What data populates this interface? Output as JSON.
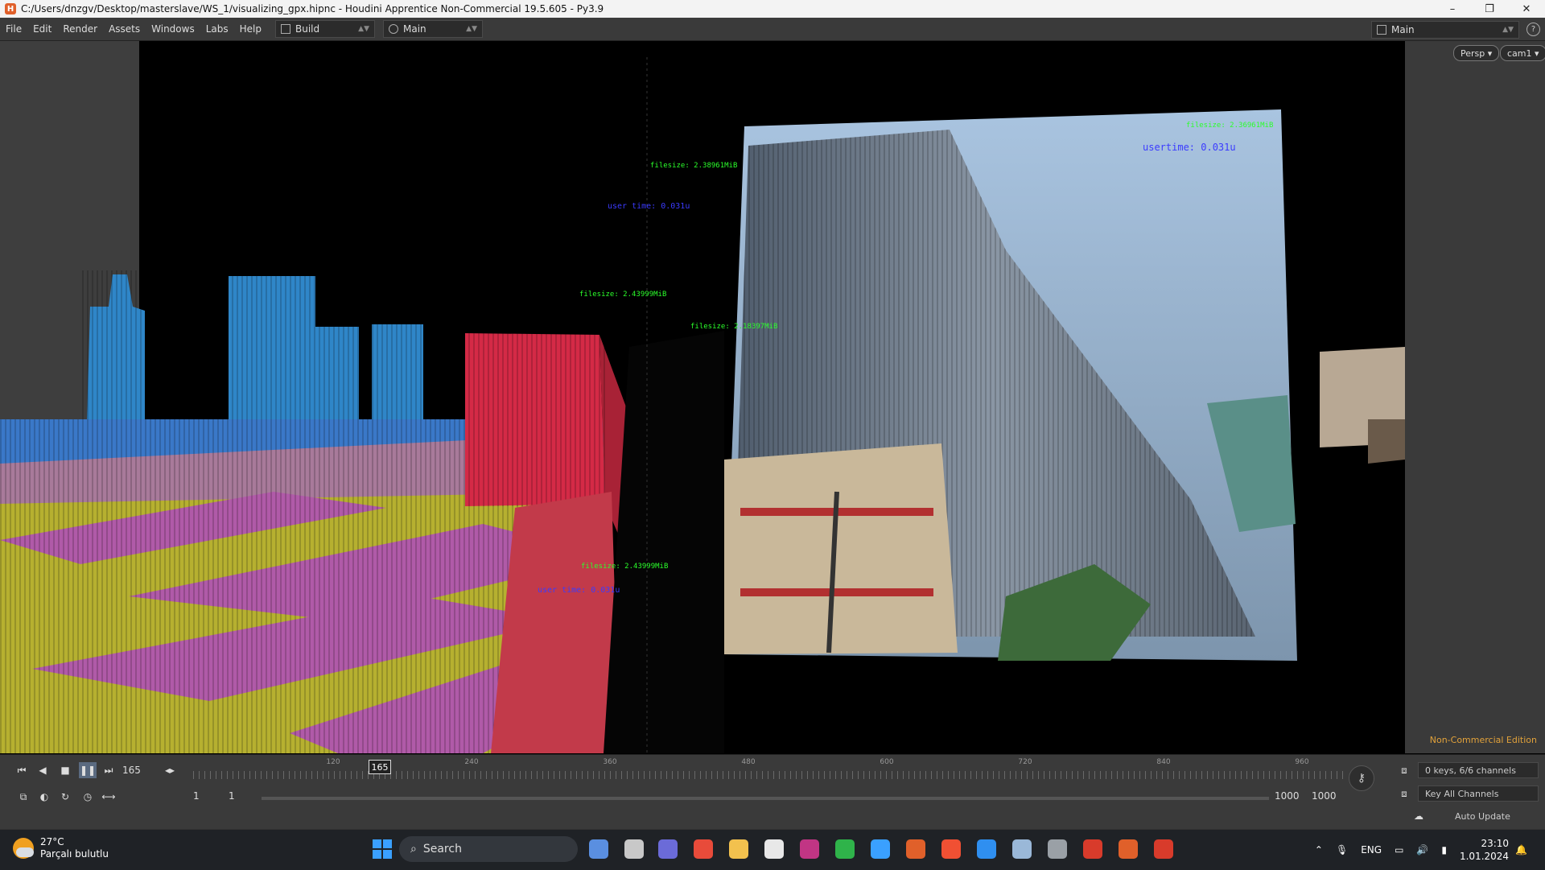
{
  "window": {
    "title": "C:/Users/dnzgv/Desktop/masterslave/WS_1/visualizing_gpx.hipnc - Houdini Apprentice Non-Commercial 19.5.605 - Py3.9",
    "app_icon": "houdini-icon",
    "controls": [
      "–",
      "❐",
      "✕"
    ]
  },
  "menubar": {
    "items": [
      "File",
      "Edit",
      "Render",
      "Assets",
      "Windows",
      "Labs",
      "Help"
    ],
    "desktop_select": "Build",
    "pane_select": "Main",
    "right_select": "Main",
    "help_label": "?"
  },
  "viewport": {
    "camera_view": "Persp",
    "camera_name": "cam1",
    "edition_label": "Non-Commercial Edition",
    "overlay_texts": [
      {
        "text": "filesize: 2.38961MiB",
        "color": "#2bff2b"
      },
      {
        "text": "filesize: 2.43999MiB",
        "color": "#2bff2b"
      },
      {
        "text": "user time: 0.031u",
        "color": "#3b3bff"
      },
      {
        "text": "filesize: 2.18397MiB",
        "color": "#2bff2b"
      },
      {
        "text": "filesize: 2.43999MiB",
        "color": "#2bff2b"
      },
      {
        "text": "usertime: 0.031u",
        "color": "#3b3bff"
      },
      {
        "text": "filesize: 2.36961MiB",
        "color": "#2bff2b"
      },
      {
        "text": "user time: 0.031u",
        "color": "#3b3bff"
      }
    ]
  },
  "timeline": {
    "frame_value": "165",
    "current_frame": "165",
    "ruler_labels": [
      "120",
      "240",
      "360",
      "480",
      "600",
      "720",
      "840",
      "960"
    ],
    "start_frame": "1",
    "start_frame_2": "1",
    "end_frame": "1000",
    "end_frame_2": "1000",
    "channels_label": "0 keys, 6/6 channels",
    "key_all_label": "Key All Channels",
    "auto_update_label": "Auto Update"
  },
  "taskbar": {
    "temperature": "27°C",
    "weather": "Parçalı bulutlu",
    "search_placeholder": "Search",
    "language": "ENG",
    "time": "23:10",
    "date": "1.01.2024",
    "apps": [
      {
        "name": "windows-start-icon",
        "color": "#3aa0ff"
      },
      {
        "name": "widgets-icon",
        "color": "#5a8fe0"
      },
      {
        "name": "task-view-icon",
        "color": "#c8c8c8"
      },
      {
        "name": "teams-chat-icon",
        "color": "#6b6bd8"
      },
      {
        "name": "chrome-icon",
        "color": "#e84b3a"
      },
      {
        "name": "file-explorer-icon",
        "color": "#f2c14e"
      },
      {
        "name": "cursor-app-icon",
        "color": "#e8e8e8"
      },
      {
        "name": "instagram-icon",
        "color": "#c13584"
      },
      {
        "name": "xbox-icon",
        "color": "#2fb34a"
      },
      {
        "name": "notes-app-icon",
        "color": "#3aa0ff"
      },
      {
        "name": "houdini-launcher-icon",
        "color": "#e0602a"
      },
      {
        "name": "git-app-icon",
        "color": "#f05033"
      },
      {
        "name": "vscode-icon",
        "color": "#2f8ff0"
      },
      {
        "name": "image-viewer-icon",
        "color": "#9ab8d8"
      },
      {
        "name": "settings-icon",
        "color": "#9aa0a6"
      },
      {
        "name": "red-app-icon",
        "color": "#d83b2b"
      },
      {
        "name": "houdini-active-icon",
        "color": "#e0602a"
      },
      {
        "name": "houdini-alt-icon",
        "color": "#d83b2b"
      }
    ]
  }
}
